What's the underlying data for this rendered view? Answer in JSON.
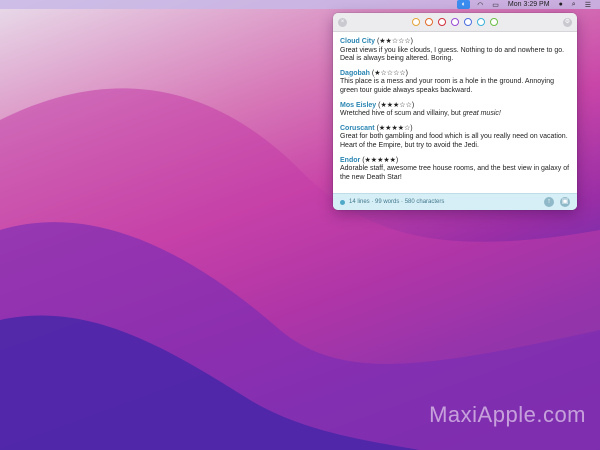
{
  "menubar": {
    "icons": [
      "app-icon",
      "wifi-icon",
      "battery-icon",
      "user-icon",
      "search-icon",
      "control-center-icon"
    ],
    "datetime": "Mon 3:29 PM"
  },
  "popup": {
    "swatch_colors": [
      "#e7a33a",
      "#e06a2a",
      "#d1303a",
      "#9a4bd3",
      "#4b6de0",
      "#3cb2d8",
      "#6bbd45"
    ],
    "entries": [
      {
        "title": "Cloud City",
        "stars": "(★★☆☆☆)",
        "text": "Great views if you like clouds, I guess. Nothing to do and nowhere to go. Deal is always being altered. Boring."
      },
      {
        "title": "Dagobah",
        "stars": "(★☆☆☆☆)",
        "text": "This place is a mess and your room is a hole in the ground. Annoying green tour guide always speaks backward."
      },
      {
        "title": "Mos Eisley",
        "stars": "(★★★☆☆)",
        "text": "Wretched hive of scum and villainy, but ",
        "text_em": "great music!"
      },
      {
        "title": "Coruscant",
        "stars": "(★★★★☆)",
        "text": "Great for both gambling and food which is all you really need on vacation. Heart of the Empire, but try to avoid the Jedi."
      },
      {
        "title": "Endor",
        "stars": "(★★★★★)",
        "text": "Adorable staff, awesome tree house rooms, and the best view in galaxy of the new Death Star!"
      }
    ],
    "footer": {
      "stats": "14 lines · 99 words · 580 characters"
    }
  },
  "watermark": "MaxiApple.com"
}
